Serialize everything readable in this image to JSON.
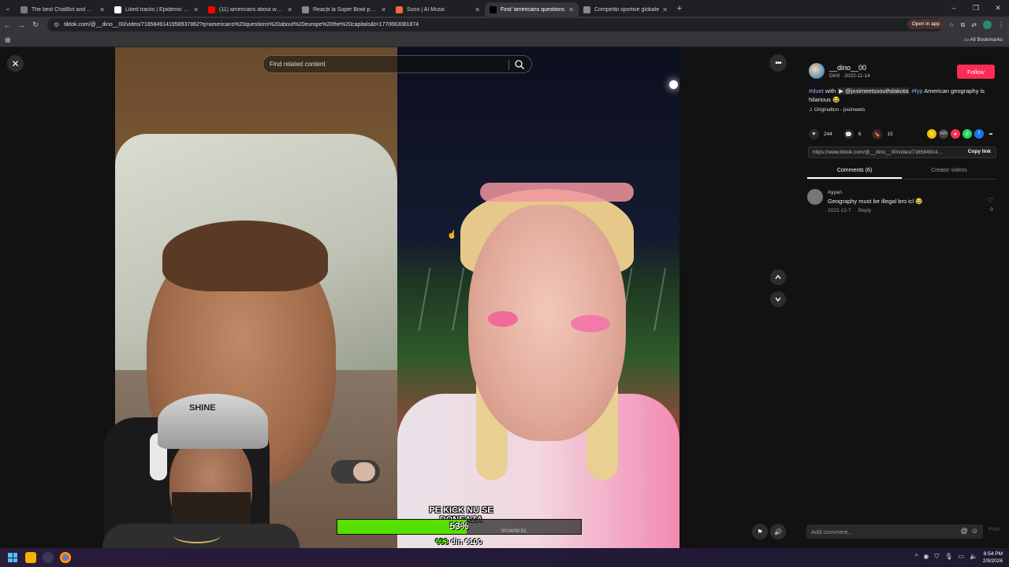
{
  "browser": {
    "tabs": [
      {
        "label": "The best ChatBot and Widgets",
        "color": "#7a7a7a"
      },
      {
        "label": "Liked tracks | Epidemic Sound",
        "color": "#ffffff"
      },
      {
        "label": "(11) americans about world cu",
        "color": "#ff0000"
      },
      {
        "label": "Reacții la Super Bowl pe Kick",
        "color": "#888888"
      },
      {
        "label": "Suno | AI Music",
        "color": "#f06a3a"
      },
      {
        "label": "Find 'americans questions",
        "color": "#000000",
        "active": true
      },
      {
        "label": "Competiții sportive globale",
        "color": "#888888"
      }
    ],
    "url": "tiktok.com/@__dino__00/video/7165849141958937862?q=americans%20questions%20about%20europe%20the%20capitals&t=1770663081874",
    "open_in_app": "Open in app",
    "all_bookmarks": "All Bookmarks"
  },
  "video": {
    "search_placeholder": "Find related content",
    "timecode": "00:04/00:51"
  },
  "overlay": {
    "donation_title": "PE KICK NU SE DONEAZA",
    "progress": 0.53,
    "progress_label": "53%",
    "raised": "€53",
    "goal_prefix": " din ",
    "goal": "€100",
    "cap_text": "SHINE"
  },
  "sidebar": {
    "author_name": "__dino__00",
    "author_sub": "Din0 · 2022-11-14",
    "follow": "Follow",
    "desc_tag1": "#duet",
    "desc_with": " with ",
    "desc_mention": "▶ @josimeetssouthdakota",
    "desc_tag2": "#fyp",
    "desc_text": " American geography is hilarious 😂",
    "sound": "Originalton - josimeets",
    "likes": "244",
    "comments_count": "6",
    "saves": "15",
    "link": "https://www.tiktok.com/@__dino__00/video/716584914...",
    "copy_link": "Copy link",
    "tab_comments": "Comments (6)",
    "tab_creator": "Creator videos",
    "comment": {
      "user": "Ayyan",
      "text": "Geography must be illegal bro icl 😂",
      "date": "2022-12-7",
      "reply": "Reply",
      "likes": "0"
    },
    "add_comment_placeholder": "Add comment...",
    "post": "Post"
  },
  "taskbar": {
    "time": "8:54 PM",
    "date": "2/9/2026"
  }
}
